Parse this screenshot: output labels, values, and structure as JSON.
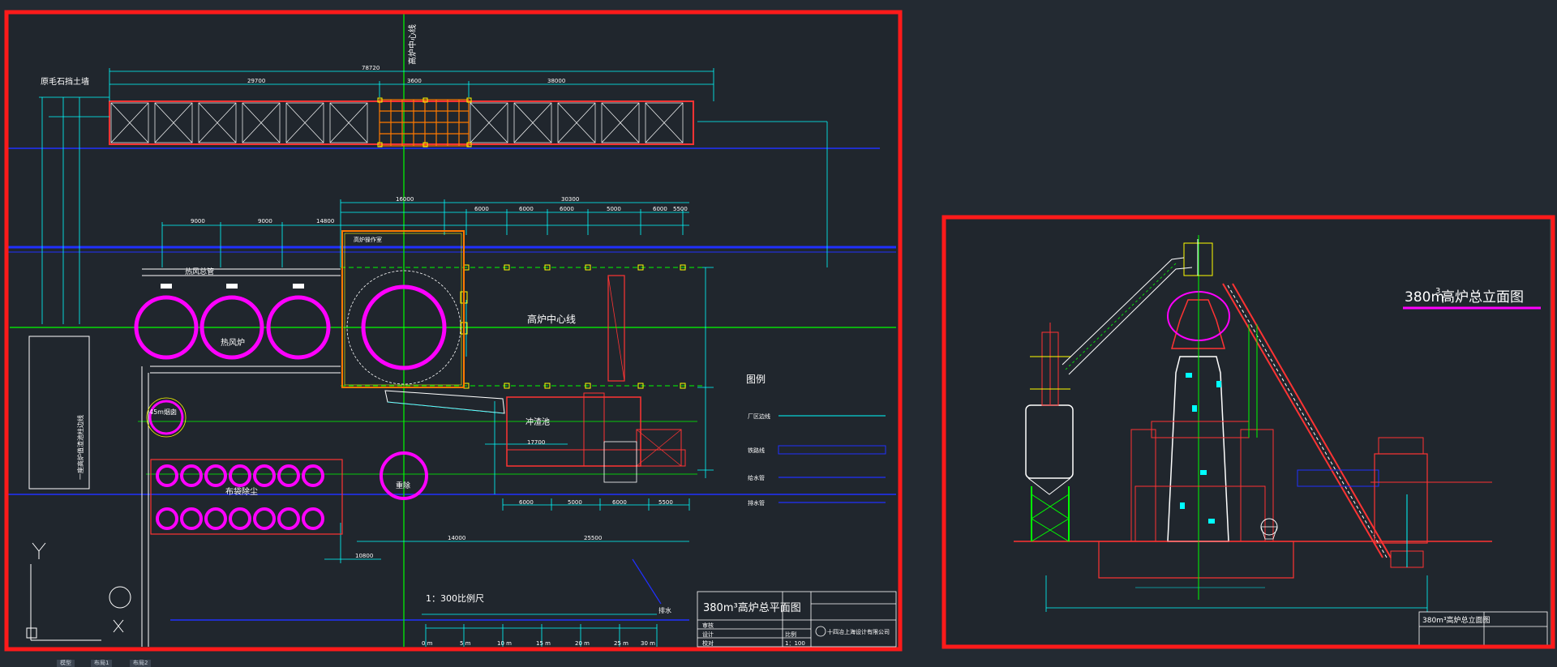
{
  "colors": {
    "background": "#232a32",
    "highlight_frame": "#ff1a1a",
    "dim_line": "#00ffff",
    "structure": "#ff3333",
    "stove": "#ff00ff",
    "column": "#ffff00",
    "pipe": "#ffffff",
    "center_line": "#00ff00",
    "utility_line": "#2030ff"
  },
  "plan": {
    "axis_label": "高炉中心线",
    "center_line_label": "高炉中心线",
    "wall_label": "原毛石挡土墙",
    "hot_air_pipe_label": "热风总管",
    "stove_label": "热风炉",
    "chimney_label": "45m烟囱",
    "baghouse_label": "布袋除尘",
    "dust_catcher_label": "重除",
    "slag_pool_label": "冲渣池",
    "building_label": "高炉操作室",
    "left_box_label": "一座高炉值渣池柱边线",
    "scale_label": "1：300比例尺",
    "drain_label": "排水",
    "dims": {
      "top_total": "78720",
      "top_left": "29700",
      "top_mid": "3600",
      "top_right": "38000",
      "row2_a": "16000",
      "row2_b": "30300",
      "row3_a": "9000",
      "row3_b": "9000",
      "row3_c": "14800",
      "row3_d": "6000",
      "row3_e": "6000",
      "row3_f": "6000",
      "row3_g": "5000",
      "row3_h": "6000",
      "row3_i": "5500",
      "bottom_a": "6000",
      "bottom_b": "5000",
      "bottom_c": "6000",
      "bottom_d": "5500",
      "bottom_total1": "14000",
      "bottom_total2": "25500",
      "slag_dim": "17700",
      "left_dim": "10800"
    },
    "legend": {
      "title": "图例",
      "items": [
        "厂区边线",
        "铁路线",
        "给水管",
        "排水管"
      ]
    },
    "scale_ticks": [
      "0 m",
      "5 m",
      "10 m",
      "15 m",
      "20 m",
      "25 m",
      "30 m"
    ],
    "title_block": {
      "title": "380m³高炉总平面图",
      "rows": [
        "审核",
        "设计",
        "校对"
      ],
      "scale_key": "比例",
      "scale_value": "1：100",
      "company": "十四冶上海设计有限公司"
    }
  },
  "elevation": {
    "title_main": "380m",
    "title_sup": "3",
    "title_rest": "高炉总立面图",
    "title_block_title": "380m³高炉总立面图"
  },
  "tabs": [
    "模型",
    "布局1",
    "布局2"
  ]
}
